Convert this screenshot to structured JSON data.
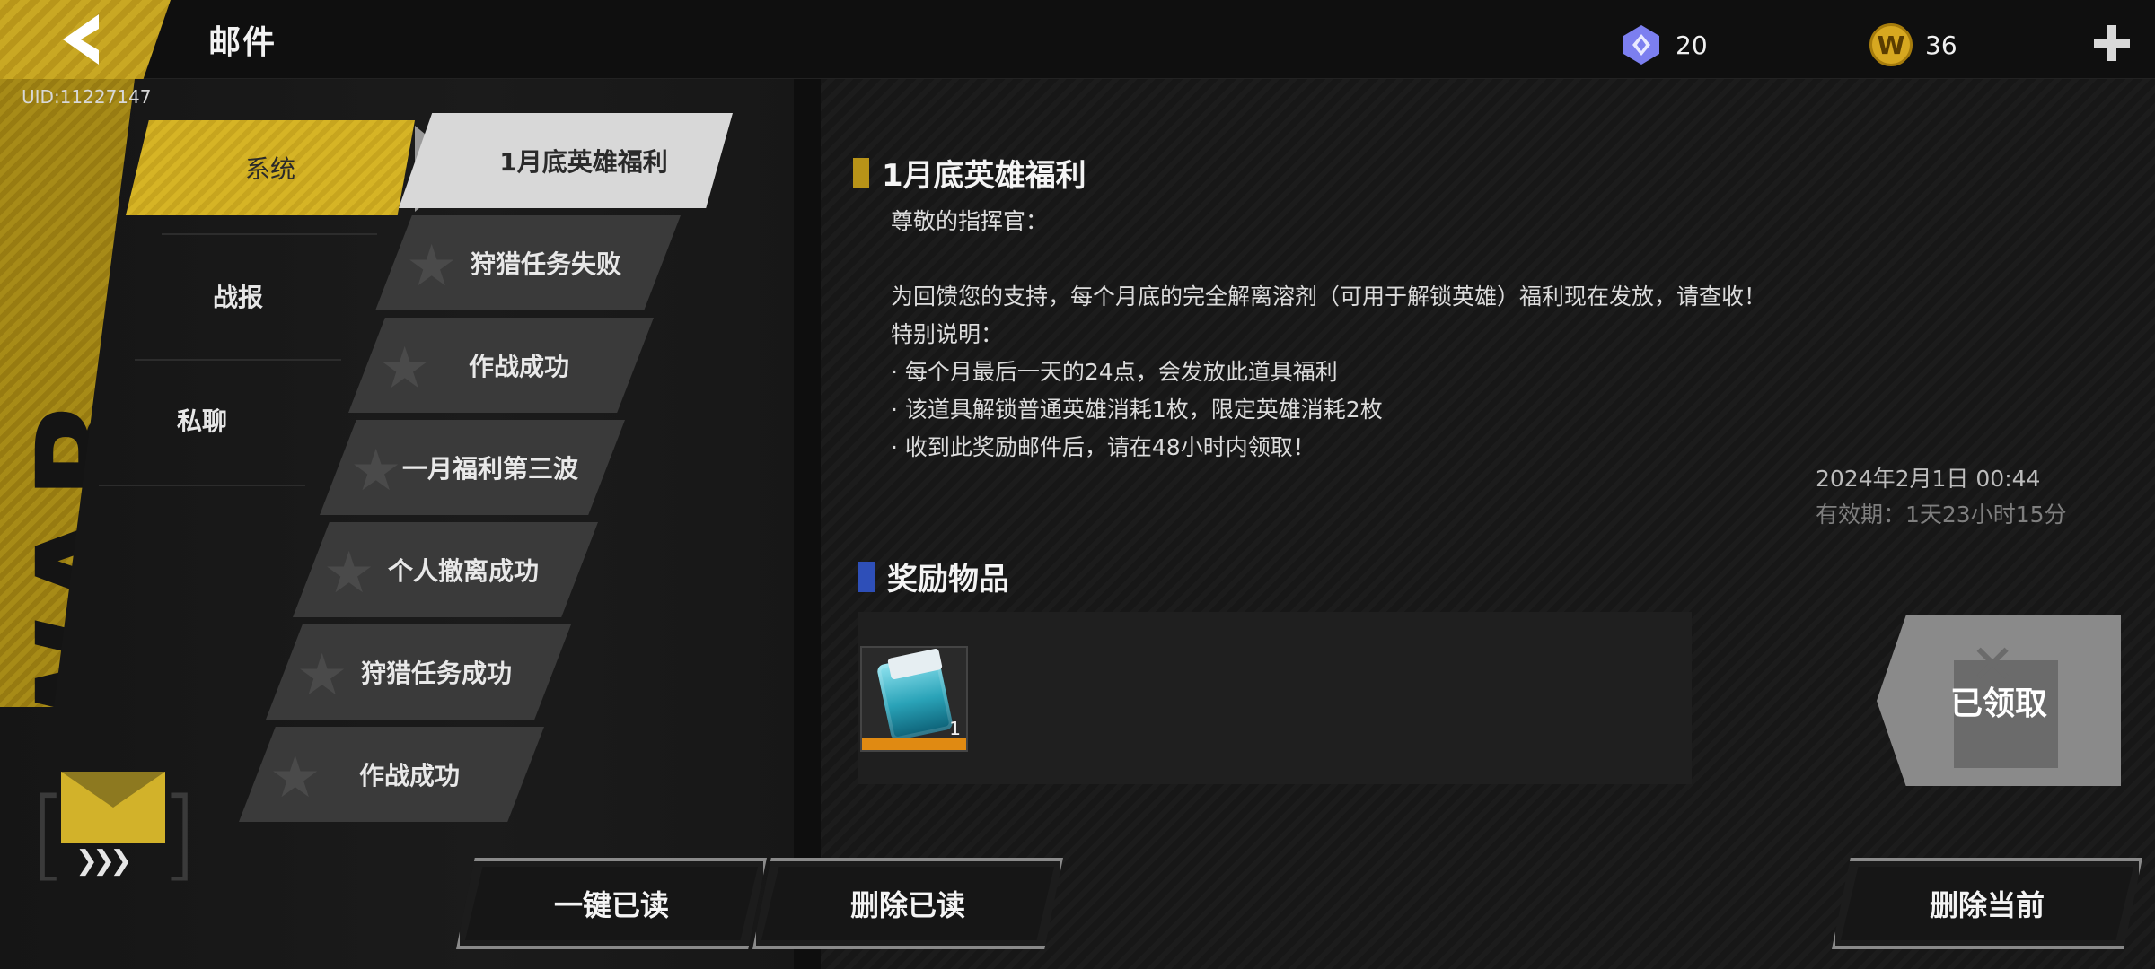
{
  "header": {
    "title": "邮件",
    "uid": "UID:11227147",
    "gems": "20",
    "coins": "36",
    "coin_letter": "W"
  },
  "side_deco_text": "THE WAR",
  "categories": [
    {
      "label": "系统"
    },
    {
      "label": "战报"
    },
    {
      "label": "私聊"
    }
  ],
  "mail_list": [
    {
      "label": "1月底英雄福利"
    },
    {
      "label": "狩猎任务失败"
    },
    {
      "label": "作战成功"
    },
    {
      "label": "一月福利第三波"
    },
    {
      "label": "个人撤离成功"
    },
    {
      "label": "狩猎任务成功"
    },
    {
      "label": "作战成功"
    }
  ],
  "mail": {
    "title": "1月底英雄福利",
    "body": "尊敬的指挥官：\n\n为回馈您的支持，每个月底的完全解离溶剂（可用于解锁英雄）福利现在发放，请查收！\n特别说明：\n· 每个月最后一天的24点，会发放此道具福利\n· 该道具解锁普通英雄消耗1枚，限定英雄消耗2枚\n· 收到此奖励邮件后，请在48小时内领取！",
    "date": "2024年2月1日  00:44",
    "validity": "有效期：1天23小时15分"
  },
  "rewards": {
    "title": "奖励物品",
    "items": [
      {
        "qty": "1"
      }
    ],
    "claimed_label": "已领取"
  },
  "buttons": {
    "mark_all_read": "一键已读",
    "delete_read": "删除已读",
    "delete_current": "删除当前"
  },
  "icons": {
    "back": "back-arrow-icon",
    "gem": "gem-icon",
    "coin": "coin-icon",
    "plus": "plus-icon",
    "mail": "envelope-icon"
  },
  "colors": {
    "accent_gold": "#d6b425",
    "accent_blue": "#2e4fb8",
    "reward_orange": "#e08a12"
  }
}
